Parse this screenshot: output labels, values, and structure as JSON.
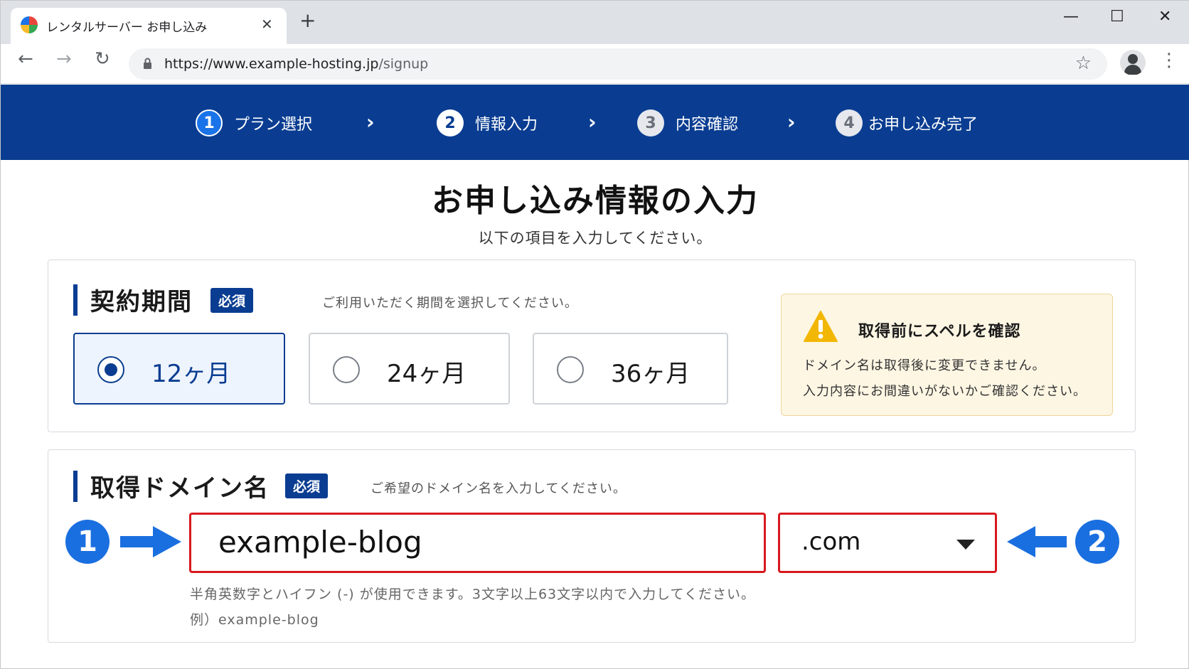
{
  "browser": {
    "tab_title": "レンタルサーバー お申し込み",
    "tab_close": "✕",
    "new_tab": "+",
    "minimize": "—",
    "maximize": "☐",
    "close": "✕",
    "back": "←",
    "forward": "→",
    "reload": "↻",
    "url_host": "https://www.example-hosting.jp",
    "url_path": "/signup",
    "star": "☆",
    "menu": "⋮",
    "favicon_colors": [
      "#1a73e8",
      "#e8453c",
      "#f9bb2d",
      "#34a853"
    ]
  },
  "steps": [
    {
      "num": "1",
      "label": "プラン選択"
    },
    {
      "num": "2",
      "label": "情報入力"
    },
    {
      "num": "3",
      "label": "内容確認"
    },
    {
      "num": "4",
      "label": "お申し込み完了"
    }
  ],
  "step_separator": "›",
  "page": {
    "title": "お申し込み情報の入力",
    "subtitle": "以下の項目を入力してください。"
  },
  "contract": {
    "title": "契約期間",
    "required": "必須",
    "hint": "ご利用いただく期間を選択してください。",
    "options": [
      {
        "label": "12ヶ月",
        "selected": true
      },
      {
        "label": "24ヶ月",
        "selected": false
      },
      {
        "label": "36ヶ月",
        "selected": false
      }
    ]
  },
  "warning": {
    "title": "取得前にスペルを確認",
    "line1": "ドメイン名は取得後に変更できません。",
    "line2": "入力内容にお間違いがないかご確認ください。"
  },
  "domain": {
    "title": "取得ドメイン名",
    "required": "必須",
    "hint": "ご希望のドメイン名を入力してください。",
    "name_value": "example-blog",
    "tld_value": ".com",
    "note1": "半角英数字とハイフン (-) が使用できます。3文字以上63文字以内で入力してください。",
    "note2": "例）example-blog"
  },
  "callouts": {
    "one": "1",
    "two": "2"
  },
  "colors": {
    "brand_navy": "#0a3d91",
    "callout_blue": "#1a6fe0",
    "highlight_red": "#d7191f",
    "warning_bg": "#fdf6e3",
    "warning_icon": "#f2b705"
  }
}
